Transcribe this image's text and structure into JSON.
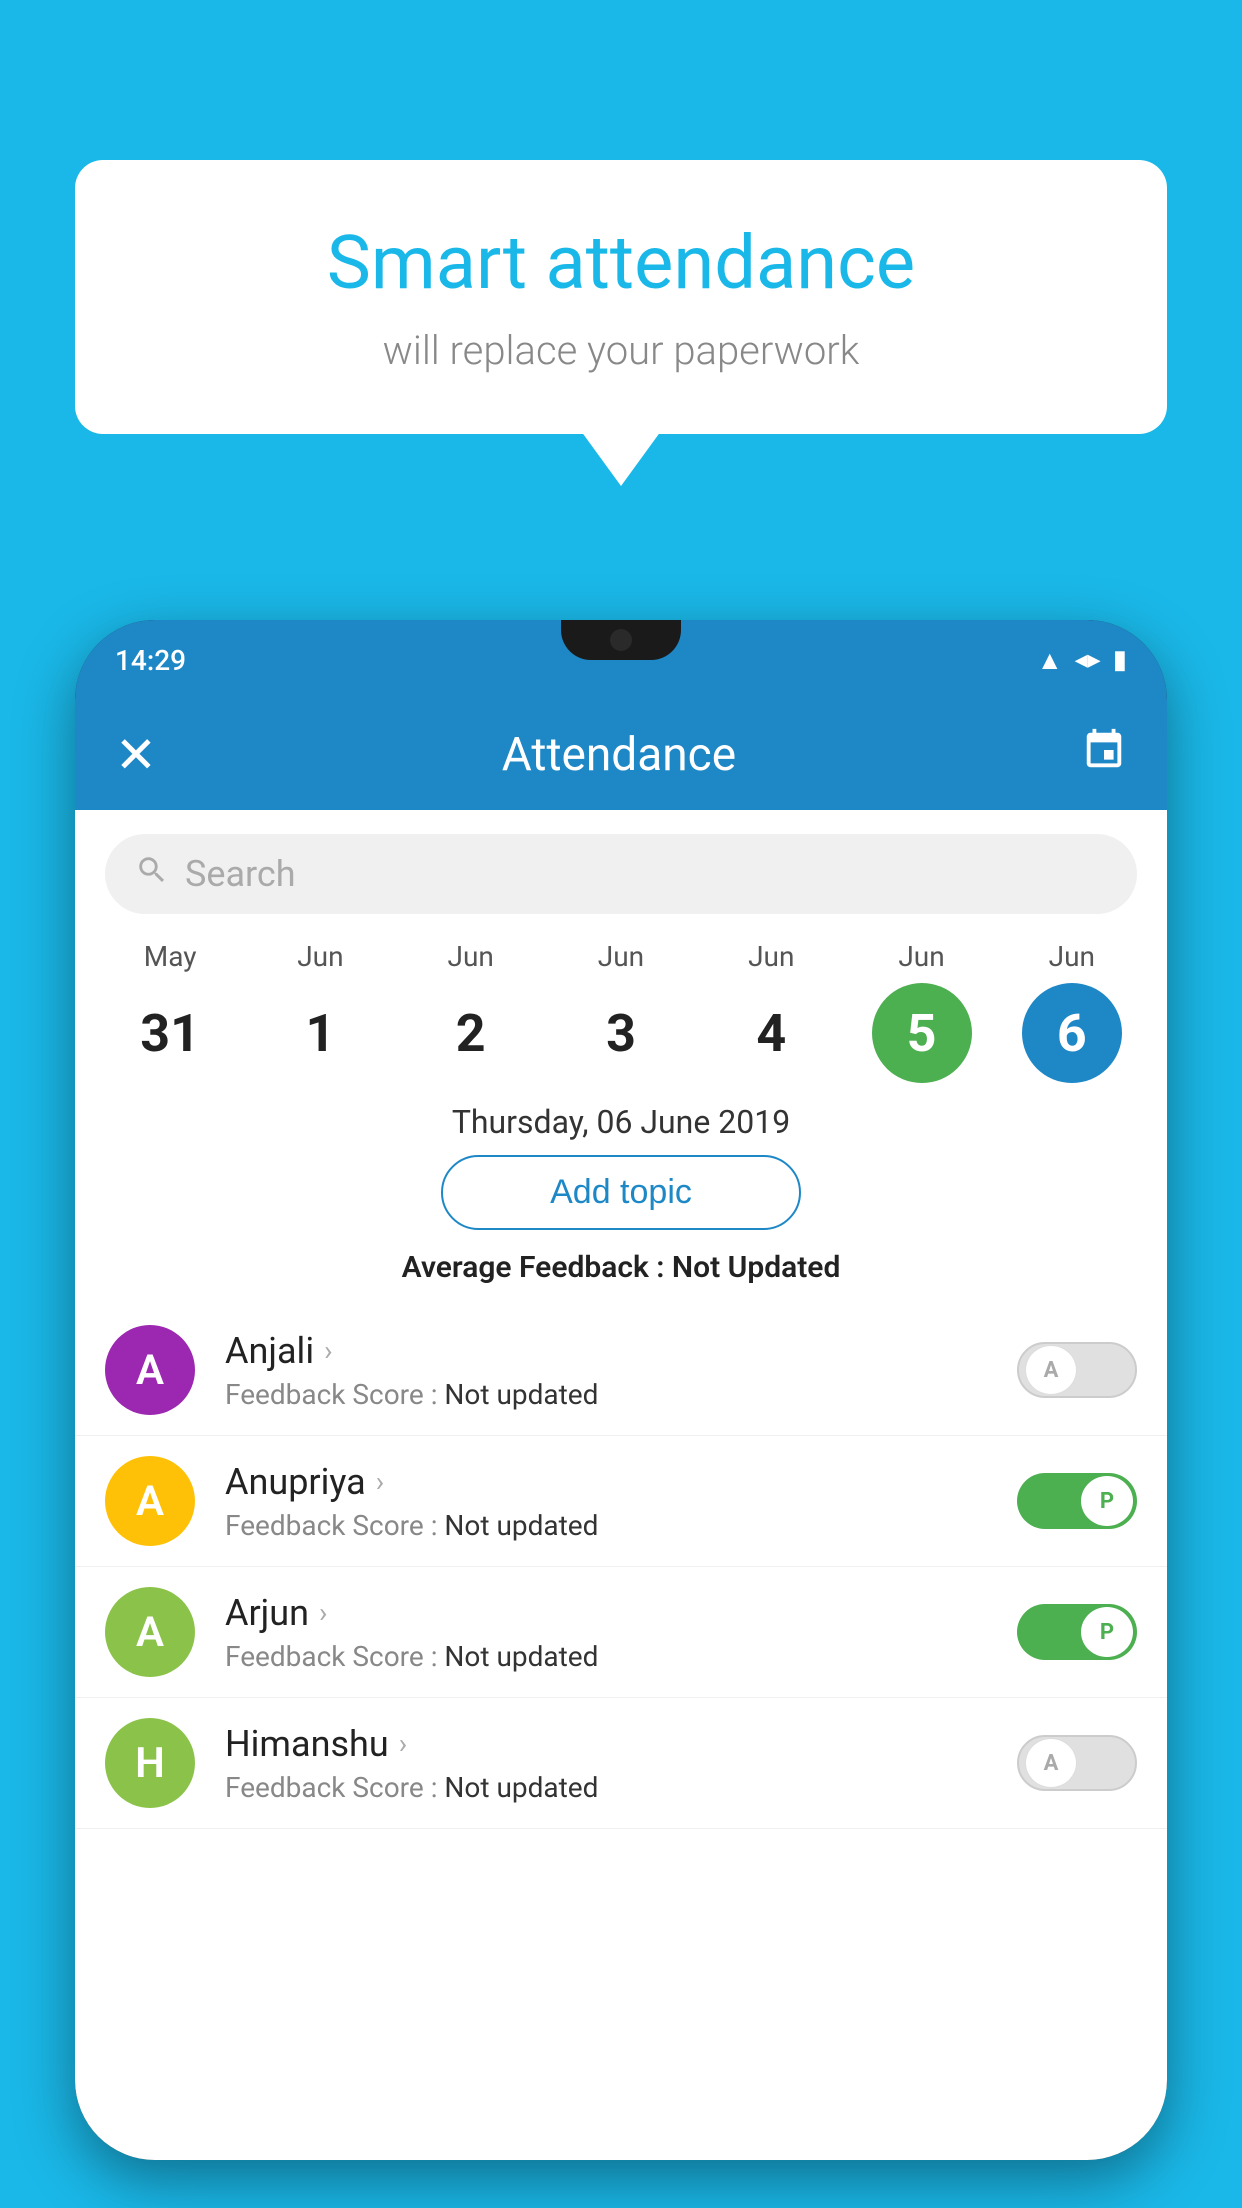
{
  "background_color": "#1ab8e8",
  "speech_bubble": {
    "title": "Smart attendance",
    "subtitle": "will replace your paperwork"
  },
  "status_bar": {
    "time": "14:29",
    "icons": [
      "wifi",
      "signal",
      "battery"
    ]
  },
  "app_header": {
    "title": "Attendance",
    "close_label": "✕",
    "calendar_label": "📅"
  },
  "search": {
    "placeholder": "Search"
  },
  "dates": [
    {
      "month": "May",
      "day": "31",
      "state": "normal"
    },
    {
      "month": "Jun",
      "day": "1",
      "state": "normal"
    },
    {
      "month": "Jun",
      "day": "2",
      "state": "normal"
    },
    {
      "month": "Jun",
      "day": "3",
      "state": "normal"
    },
    {
      "month": "Jun",
      "day": "4",
      "state": "normal"
    },
    {
      "month": "Jun",
      "day": "5",
      "state": "today"
    },
    {
      "month": "Jun",
      "day": "6",
      "state": "selected"
    }
  ],
  "selected_date_label": "Thursday, 06 June 2019",
  "add_topic_label": "Add topic",
  "avg_feedback_label": "Average Feedback :",
  "avg_feedback_value": "Not Updated",
  "students": [
    {
      "name": "Anjali",
      "avatar_letter": "A",
      "avatar_color": "#9c27b0",
      "feedback_label": "Feedback Score :",
      "feedback_value": "Not updated",
      "attendance": "absent",
      "toggle_label": "A"
    },
    {
      "name": "Anupriya",
      "avatar_letter": "A",
      "avatar_color": "#ffc107",
      "feedback_label": "Feedback Score :",
      "feedback_value": "Not updated",
      "attendance": "present",
      "toggle_label": "P"
    },
    {
      "name": "Arjun",
      "avatar_letter": "A",
      "avatar_color": "#8bc34a",
      "feedback_label": "Feedback Score :",
      "feedback_value": "Not updated",
      "attendance": "present",
      "toggle_label": "P"
    },
    {
      "name": "Himanshu",
      "avatar_letter": "H",
      "avatar_color": "#8bc34a",
      "feedback_label": "Feedback Score :",
      "feedback_value": "Not updated",
      "attendance": "absent",
      "toggle_label": "A"
    }
  ]
}
